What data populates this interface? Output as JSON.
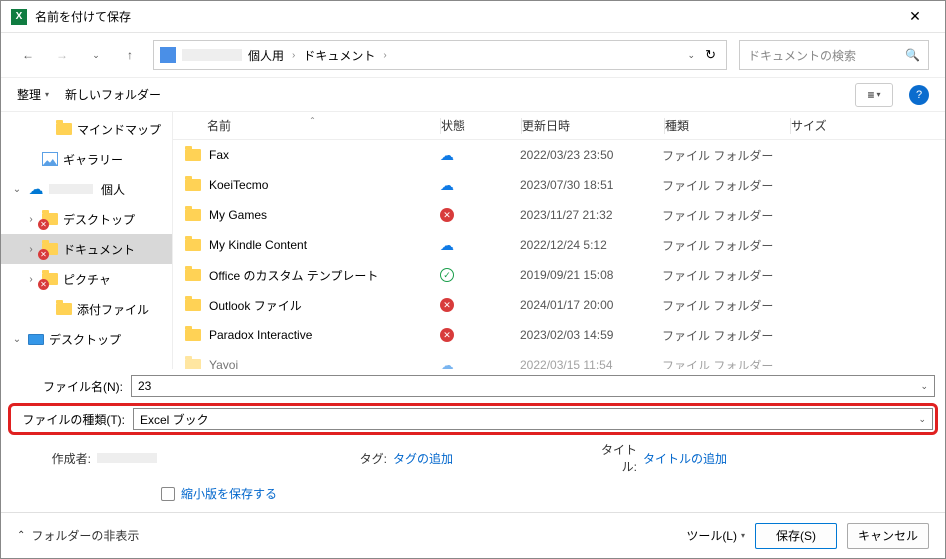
{
  "window": {
    "title": "名前を付けて保存"
  },
  "address": {
    "segment1": "個人用",
    "segment2": "ドキュメント"
  },
  "search": {
    "placeholder": "ドキュメントの検索"
  },
  "toolbar": {
    "organize": "整理",
    "newfolder": "新しいフォルダー"
  },
  "tree": {
    "items": [
      {
        "label": "マインドマップ",
        "icon": "folder",
        "indent": 38,
        "exp": ""
      },
      {
        "label": "ギャラリー",
        "icon": "picture",
        "indent": 24,
        "exp": ""
      },
      {
        "label": "個人",
        "icon": "cloud",
        "indent": 10,
        "exp": "v",
        "obscured": true
      },
      {
        "label": "デスクトップ",
        "icon": "folder-err",
        "indent": 24,
        "exp": ">"
      },
      {
        "label": "ドキュメント",
        "icon": "folder-err",
        "indent": 24,
        "exp": ">",
        "selected": true
      },
      {
        "label": "ピクチャ",
        "icon": "folder-err",
        "indent": 24,
        "exp": ">"
      },
      {
        "label": "添付ファイル",
        "icon": "folder",
        "indent": 38,
        "exp": ""
      },
      {
        "label": "デスクトップ",
        "icon": "monitor",
        "indent": 10,
        "exp": "v"
      }
    ]
  },
  "columns": {
    "name": "名前",
    "status": "状態",
    "date": "更新日時",
    "type": "種類",
    "size": "サイズ"
  },
  "files": [
    {
      "name": "Fax",
      "status": "cloud",
      "date": "2022/03/23 23:50",
      "type": "ファイル フォルダー"
    },
    {
      "name": "KoeiTecmo",
      "status": "cloud",
      "date": "2023/07/30 18:51",
      "type": "ファイル フォルダー"
    },
    {
      "name": "My Games",
      "status": "err",
      "date": "2023/11/27 21:32",
      "type": "ファイル フォルダー"
    },
    {
      "name": "My Kindle Content",
      "status": "cloud",
      "date": "2022/12/24 5:12",
      "type": "ファイル フォルダー"
    },
    {
      "name": "Office のカスタム テンプレート",
      "status": "ok",
      "date": "2019/09/21 15:08",
      "type": "ファイル フォルダー"
    },
    {
      "name": "Outlook ファイル",
      "status": "err",
      "date": "2024/01/17 20:00",
      "type": "ファイル フォルダー"
    },
    {
      "name": "Paradox Interactive",
      "status": "err",
      "date": "2023/02/03 14:59",
      "type": "ファイル フォルダー"
    },
    {
      "name": "Yayoi",
      "status": "cloud",
      "date": "2022/03/15 11:54",
      "type": "ファイル フォルダー"
    }
  ],
  "form": {
    "filename_label": "ファイル名(N):",
    "filename_value": "23",
    "filetype_label": "ファイルの種類(T):",
    "filetype_value": "Excel ブック",
    "author_label": "作成者:",
    "tag_label": "タグ:",
    "tag_value": "タグの追加",
    "title_label": "タイトル:",
    "title_value": "タイトルの追加",
    "thumb_label": "縮小版を保存する"
  },
  "footer": {
    "hide_folders": "フォルダーの非表示",
    "tools": "ツール(L)",
    "save": "保存(S)",
    "cancel": "キャンセル"
  }
}
